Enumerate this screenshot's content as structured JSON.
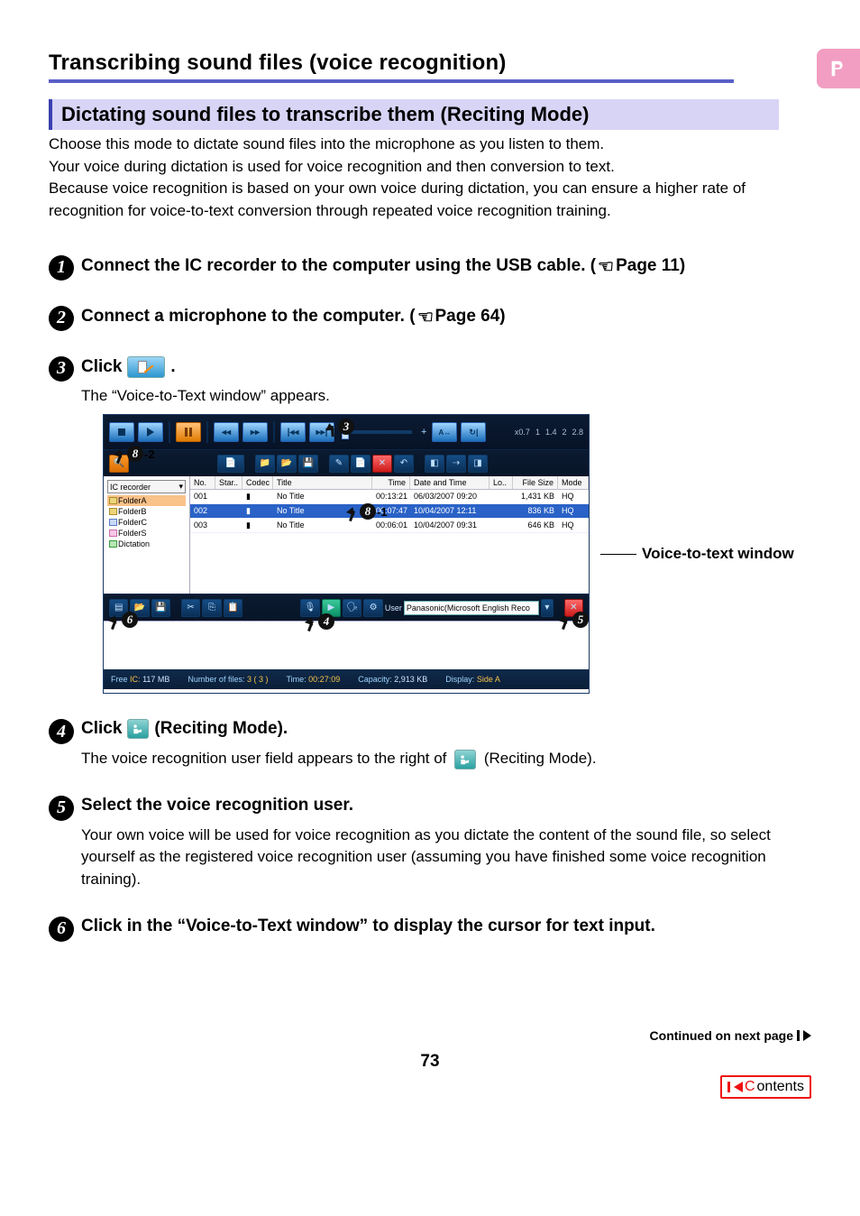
{
  "badge": "Pr",
  "title": "Transcribing sound files (voice recognition)",
  "subsection": "Dictating sound files to transcribe them (Reciting Mode)",
  "intro": [
    "Choose this mode to dictate sound files into the microphone as you listen to them.",
    "Your voice during dictation is used for voice recognition and then conversion to text.",
    "Because voice recognition is based on your own voice during dictation, you can ensure a higher rate of recognition for voice-to-text conversion through repeated voice recognition training."
  ],
  "steps": {
    "s1": "Connect the IC recorder to the computer using the USB cable. (",
    "s1_ref": " Page 11)",
    "s2": "Connect a microphone to the computer. (",
    "s2_ref": " Page 64)",
    "s3_a": "Click ",
    "s3_b": ".",
    "s3_body": "The “Voice-to-Text window” appears.",
    "s4_a": "Click ",
    "s4_b": " (Reciting Mode).",
    "s4_body_a": "The voice recognition user field appears to the right of ",
    "s4_body_b": " (Reciting Mode).",
    "s5": "Select the voice recognition user.",
    "s5_body": "Your own voice will be used for voice recognition as you dictate the content of the sound file, so select yourself as the registered voice recognition user (assuming you have finished some voice recognition training).",
    "s6": "Click in the “Voice-to-Text window” to display the cursor for text input."
  },
  "screenshot": {
    "speed_labels": [
      "x0.7",
      "1",
      "1.4",
      "2",
      "2.8"
    ],
    "search_icon": "🔍",
    "tree_top": "IC recorder",
    "tree": [
      "FolderA",
      "FolderB",
      "FolderC",
      "FolderS",
      "Dictation"
    ],
    "cols": {
      "no": "No.",
      "star": "Star..",
      "codec": "Codec",
      "title": "Title",
      "time": "Time",
      "date": "Date and Time",
      "lo": "Lo..",
      "size": "File Size",
      "mode": "Mode"
    },
    "rows": [
      {
        "no": "001",
        "title": "No Title",
        "time": "00:13:21",
        "date": "06/03/2007 09:20",
        "size": "1,431 KB",
        "mode": "HQ"
      },
      {
        "no": "002",
        "title": "No Title",
        "time": "00:07:47",
        "date": "10/04/2007 12:11",
        "size": "836 KB",
        "mode": "HQ"
      },
      {
        "no": "003",
        "title": "No Title",
        "time": "00:06:01",
        "date": "10/04/2007 09:31",
        "size": "646 KB",
        "mode": "HQ"
      }
    ],
    "user_label": "User",
    "user_value": "Panasonic(Microsoft English Reco",
    "status": {
      "free_lbl": "Free",
      "free_dev": "IC:",
      "free_val": "117 MB",
      "nfiles_lbl": "Number of files:",
      "nfiles_val": "3 ( 3 )",
      "time_lbl": "Time:",
      "time_val": "00:27:09",
      "cap_lbl": "Capacity:",
      "cap_val": "2,913 KB",
      "disp_lbl": "Display:",
      "disp_val": "Side A"
    },
    "side_label": "Voice-to-text window",
    "suffix_82": "-2",
    "suffix_81": "-1"
  },
  "continued": "Continued on next page",
  "page_num": "73",
  "contents": "Contents"
}
